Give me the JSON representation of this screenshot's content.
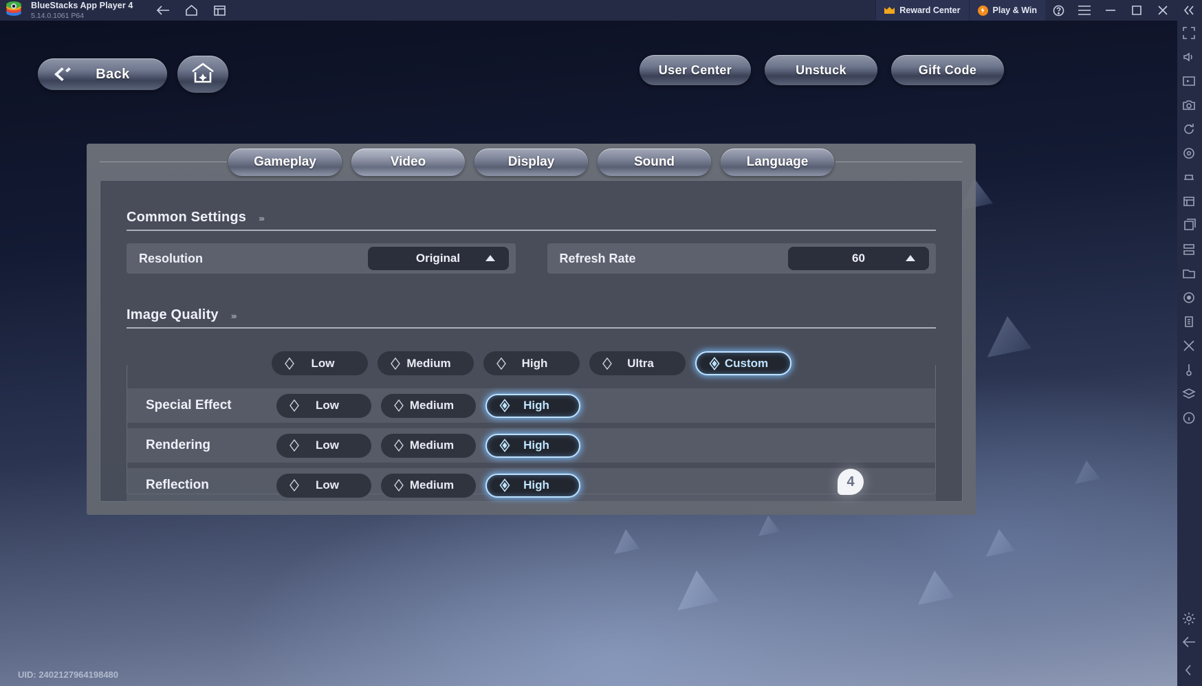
{
  "titlebar": {
    "app_name": "BlueStacks App Player 4",
    "version": "5.14.0.1061  P64",
    "nav": [
      {
        "name": "back-arrow-icon"
      },
      {
        "name": "home-icon"
      },
      {
        "name": "multi-instance-icon"
      }
    ],
    "reward_center": "Reward Center",
    "play_and_win": "Play & Win",
    "window_controls": [
      "help-icon",
      "menu-icon",
      "minimize-icon",
      "maximize-icon",
      "close-icon",
      "collapse-icon"
    ]
  },
  "game_header": {
    "back": "Back",
    "home_icon": "home-plus-icon",
    "user_center": "User Center",
    "unstuck": "Unstuck",
    "gift_code": "Gift Code"
  },
  "settings": {
    "tabs": [
      {
        "label": "Gameplay",
        "active": false
      },
      {
        "label": "Video",
        "active": true
      },
      {
        "label": "Display",
        "active": false
      },
      {
        "label": "Sound",
        "active": false
      },
      {
        "label": "Language",
        "active": false
      }
    ],
    "common": {
      "title": "Common Settings",
      "chevrons": "›››",
      "fields": [
        {
          "label": "Resolution",
          "value": "Original"
        },
        {
          "label": "Refresh Rate",
          "value": "60"
        }
      ]
    },
    "image_quality": {
      "title": "Image Quality",
      "chevrons": "›››",
      "presets": [
        {
          "label": "Low",
          "selected": false
        },
        {
          "label": "Medium",
          "selected": false
        },
        {
          "label": "High",
          "selected": false
        },
        {
          "label": "Ultra",
          "selected": false
        },
        {
          "label": "Custom",
          "selected": true
        }
      ],
      "rows": [
        {
          "label": "Special Effect",
          "options": [
            {
              "label": "Low",
              "selected": false
            },
            {
              "label": "Medium",
              "selected": false
            },
            {
              "label": "High",
              "selected": true
            }
          ]
        },
        {
          "label": "Rendering",
          "options": [
            {
              "label": "Low",
              "selected": false
            },
            {
              "label": "Medium",
              "selected": false
            },
            {
              "label": "High",
              "selected": true
            }
          ]
        },
        {
          "label": "Reflection",
          "options": [
            {
              "label": "Low",
              "selected": false
            },
            {
              "label": "Medium",
              "selected": false
            },
            {
              "label": "High",
              "selected": true
            }
          ]
        }
      ]
    }
  },
  "badge": "4",
  "uid": "UID: 2402127964198480",
  "colors": {
    "accent_glow": "#7ec4ff",
    "selected_text": "#bfe4ff",
    "titlebar_bg": "#252b45",
    "panel_bg": "#474b58",
    "reward_orange": "#f0a71c"
  }
}
